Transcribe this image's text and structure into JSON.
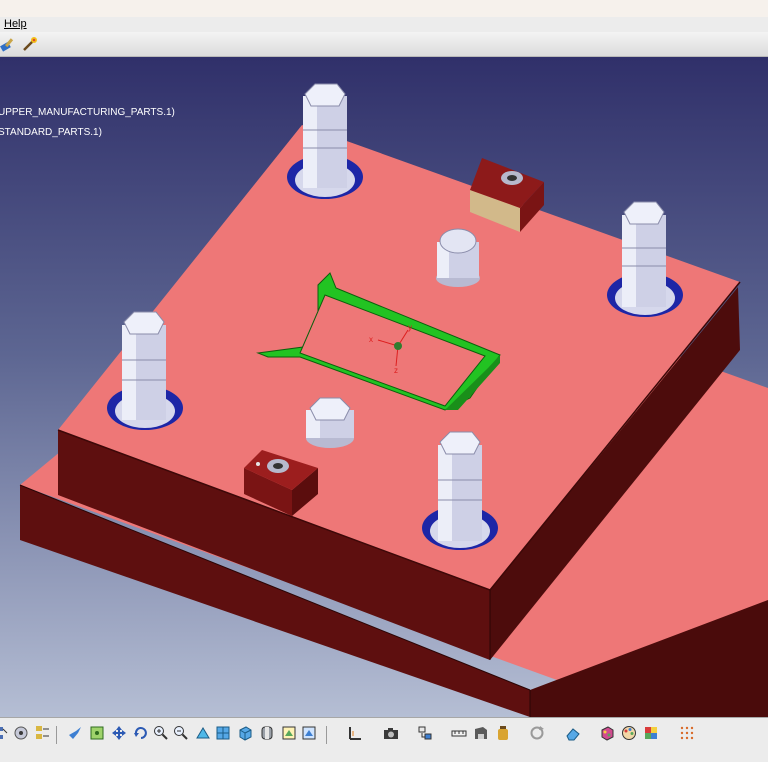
{
  "menubar": {
    "help_label": "Help"
  },
  "tree": {
    "items": [
      {
        "label": "UPPER_MANUFACTURING_PARTS.1)"
      },
      {
        "label": "STANDARD_PARTS.1)"
      }
    ]
  },
  "axis": {
    "x_label": "x",
    "y_label": "y",
    "z_label": "z"
  },
  "colors": {
    "plate_top": "#ee7777",
    "plate_side": "#5e0f0f",
    "plate_dark": "#3d0808",
    "cavity_green": "#22c322",
    "pin_color": "#ced0e6",
    "bolt_recess": "#1d26a6",
    "viewport_top": "#30306a",
    "viewport_bottom": "#b5bed4"
  },
  "toolbar_top": {
    "icons": [
      "brush-icon",
      "magic-wand-icon"
    ]
  },
  "toolbar_bottom": {
    "icons": [
      "graph-icon",
      "hub-icon",
      "spec-tree-icon",
      "fly-mode-icon",
      "fit-all-icon",
      "pan-icon",
      "rotate-icon",
      "zoom-in-icon",
      "zoom-out-icon",
      "normal-view-icon",
      "cube-view-icon",
      "iso-view-icon",
      "shading-icon",
      "hide-show-icon",
      "swap-visible-icon",
      "measure-icon",
      "camera-icon",
      "snap-icon",
      "ruler-icon",
      "save-icon",
      "bottle-icon",
      "refresh-icon",
      "eraser-icon",
      "material-icon",
      "palette-icon",
      "texture-icon",
      "grid-icon"
    ]
  }
}
